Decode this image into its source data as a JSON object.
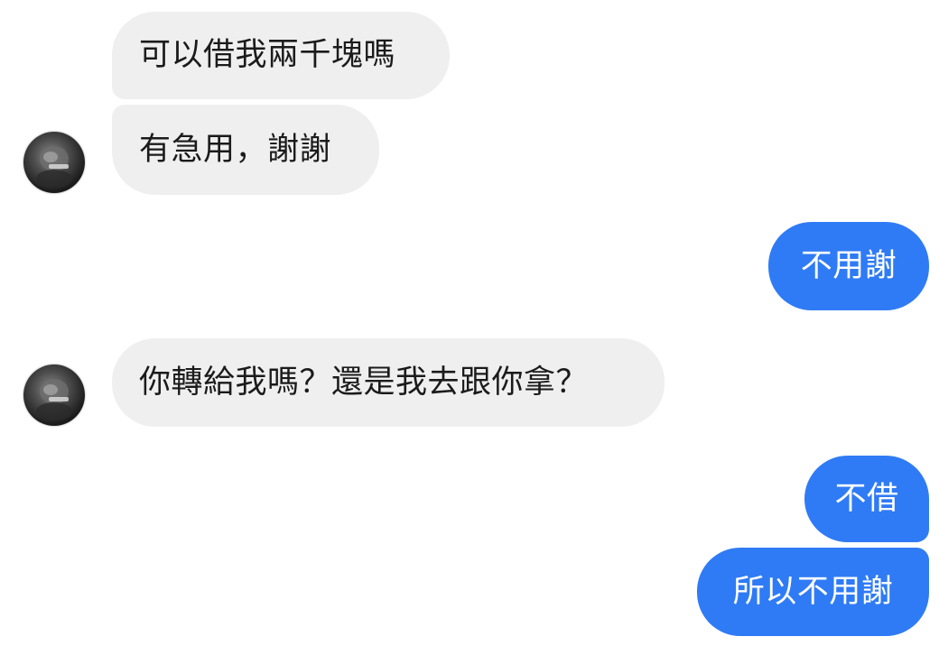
{
  "conversation": {
    "messages": [
      {
        "sender": "incoming",
        "text": "可以借我兩千塊嗎"
      },
      {
        "sender": "incoming",
        "text": "有急用，謝謝"
      },
      {
        "sender": "outgoing",
        "text": "不用謝"
      },
      {
        "sender": "incoming",
        "text": "你轉給我嗎？還是我去跟你拿？"
      },
      {
        "sender": "outgoing",
        "text": "不借"
      },
      {
        "sender": "outgoing",
        "text": "所以不用謝"
      }
    ]
  },
  "colors": {
    "incoming_bubble": "#efeff0",
    "outgoing_bubble": "#2f7bf5",
    "incoming_text": "#1b1b1b",
    "outgoing_text": "#ffffff"
  },
  "icons": {
    "avatar": "contact-avatar"
  }
}
